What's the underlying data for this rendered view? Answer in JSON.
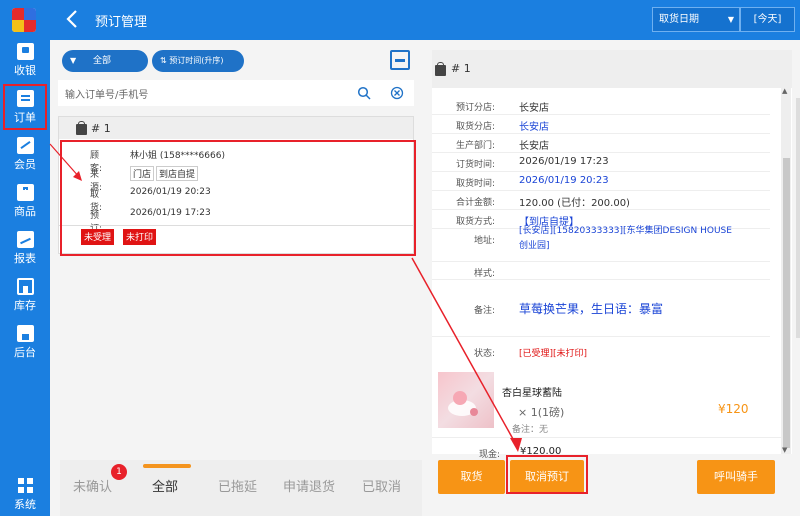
{
  "app": {
    "title": "预订管理"
  },
  "colors": {
    "primary": "#1b7fe0",
    "accent": "#f79415",
    "danger": "#e01414",
    "link": "#1a44d6",
    "highlight_box": "#e8212a"
  },
  "sidebar": {
    "items": [
      {
        "label": "收银",
        "icon": "register-icon"
      },
      {
        "label": "订单",
        "icon": "order-icon"
      },
      {
        "label": "会员",
        "icon": "member-icon"
      },
      {
        "label": "商品",
        "icon": "goods-icon"
      },
      {
        "label": "报表",
        "icon": "chart-icon"
      },
      {
        "label": "库存",
        "icon": "warehouse-icon"
      },
      {
        "label": "后台",
        "icon": "store-icon"
      }
    ],
    "system": {
      "label": "系统",
      "icon": "grid-icon"
    }
  },
  "header": {
    "date_type": "取货日期",
    "date_value": "[今天]"
  },
  "filters": {
    "all": "全部",
    "sort": "预订时间(升序)"
  },
  "search": {
    "placeholder": "输入订单号/手机号"
  },
  "order_card": {
    "number": "# 1",
    "customer_label": "顾客:",
    "customer_value": "林小姐 (158****6666)",
    "source_label": "来源:",
    "source_tags": [
      "门店",
      "到店自提"
    ],
    "pickup_label": "取货:",
    "pickup_value": "2026/01/19 20:23",
    "reserve_label": "预订:",
    "reserve_value": "2026/01/19 17:23",
    "status_tags": [
      "未受理",
      "未打印"
    ]
  },
  "tabs": {
    "unconfirmed": "未确认",
    "unconfirmed_count": "1",
    "all": "全部",
    "delayed": "已拖延",
    "refund": "申请退货",
    "cancelled": "已取消"
  },
  "detail": {
    "number": "# 1",
    "rows": [
      {
        "label": "预订分店:",
        "value": "长安店",
        "color": "normal"
      },
      {
        "label": "取货分店:",
        "value": "长安店",
        "color": "blue"
      },
      {
        "label": "生产部门:",
        "value": "长安店",
        "color": "normal"
      },
      {
        "label": "订货时间:",
        "value": "2026/01/19 17:23",
        "color": "normal"
      },
      {
        "label": "取货时间:",
        "value": "2026/01/19 20:23",
        "color": "blue"
      },
      {
        "label": "合计金额:",
        "value": "120.00  (已付：200.00)",
        "color": "normal"
      },
      {
        "label": "取货方式:",
        "value": "【到店自提】",
        "color": "blue"
      }
    ],
    "address_label": "地址:",
    "address_value_1": "[长安店][15820333333][东华集团DESIGN HOUSE",
    "address_value_2": "创业园]",
    "style_label": "样式:",
    "note_label": "备注:",
    "note_value": "草莓换芒果，生日语：暴富",
    "status_label": "状态:",
    "status_value": "[已受理][未打印]",
    "product_name": "杏白星球蓄陆",
    "product_qty": "× 1(1磅)",
    "product_note": "备注：无",
    "product_price": "¥120",
    "cash_label": "现金:",
    "cash_value": "¥120.00"
  },
  "actions": {
    "pickup": "取货",
    "cancel": "取消预订",
    "call_rider": "呼叫骑手"
  }
}
